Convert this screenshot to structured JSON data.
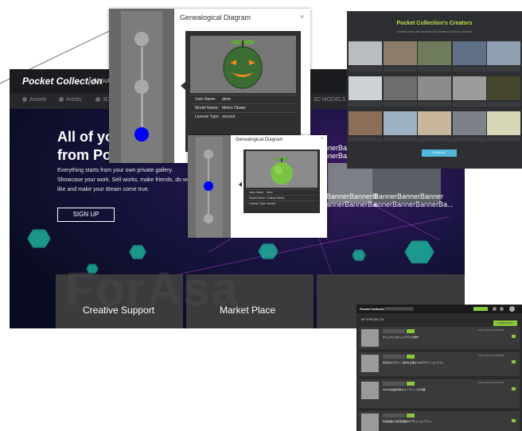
{
  "site": {
    "logo": "Pocket Collection",
    "about": "About P",
    "subnav": [
      "Assets",
      "Artists",
      "3D"
    ],
    "subnav_extra": "3D MODELS",
    "hero_title_1": "All of you",
    "hero_title_2": "from Poc",
    "hero_text_1": "Everything starts from your own private gallery.",
    "hero_text_2": "Showcase your work. Sell works, make friends, do work",
    "hero_text_3": "like and make your dream come true.",
    "signup_label": "SIGN UP",
    "card_1": "Creative Support",
    "card_2": "Market Place",
    "bg_letters": "ForAsa",
    "banner_1": "BannerBanner BannerBanner",
    "banner_2a": "BannerBannerB",
    "banner_2b": "annerBannerBa...",
    "banner_3a": "BannerBannerBanner",
    "banner_3b": "annerBannerBannerBa..."
  },
  "diagram_large": {
    "title": "Genealogical Diagram",
    "close": "×",
    "rows": [
      {
        "key": "User Name:",
        "value": "dmm"
      },
      {
        "key": "Model Name:",
        "value": "Melon Obake"
      },
      {
        "key": "License Type:",
        "value": "second"
      }
    ],
    "active_node_color": "#0000ff"
  },
  "diagram_small": {
    "title": "Genealogical Diagram",
    "close": "×",
    "rows": [
      {
        "key": "User Name:",
        "value": "dmm"
      },
      {
        "key": "Model Name:",
        "value": "Custom Melon"
      },
      {
        "key": "License Type:",
        "value": "second"
      }
    ],
    "active_node_color": "#0000ff"
  },
  "creators": {
    "title": "Pocket Collection's Creators",
    "subtitle": "Creators who have uploaded 3D models to Pocket Collection",
    "button": "VIEW ALL",
    "thumb_colors": [
      "#b9bcc1",
      "#8b7d69",
      "#6f7c5c",
      "#5f6f88",
      "#8fa0b3",
      "#cfd2d4",
      "#6d6d6d",
      "#8c8c8c",
      "#9c9c9c",
      "#46452e",
      "#8c6f58",
      "#9eb0c4",
      "#c9b79c",
      "#7e8288",
      "#d8d8b8"
    ],
    "accent": "#b8e04a",
    "button_color": "#53b9dc"
  },
  "projects": {
    "logo": "Pocket Collection",
    "search_placeholder": "Search Pocket Collection",
    "heading": "MY PROJECTS",
    "create_label": "Create Project",
    "rows": [
      {
        "title": "オリジナルロボットモデルの制作",
        "meta": "Pocket Collection 2022/11/01"
      },
      {
        "title": "家具系3Dデザイン素材を企業から3Dデザインコンテスト",
        "meta": "Pocket Collection 2022/11/01"
      },
      {
        "title": "3DCG作品制作等をオンラインでの作業",
        "meta": "Pocket Collection 2022/11/01"
      },
      {
        "title": "新規掲載中 限定版機能3Dデザインコンテスト",
        "meta": ""
      }
    ],
    "accent": "#8cc63f"
  }
}
